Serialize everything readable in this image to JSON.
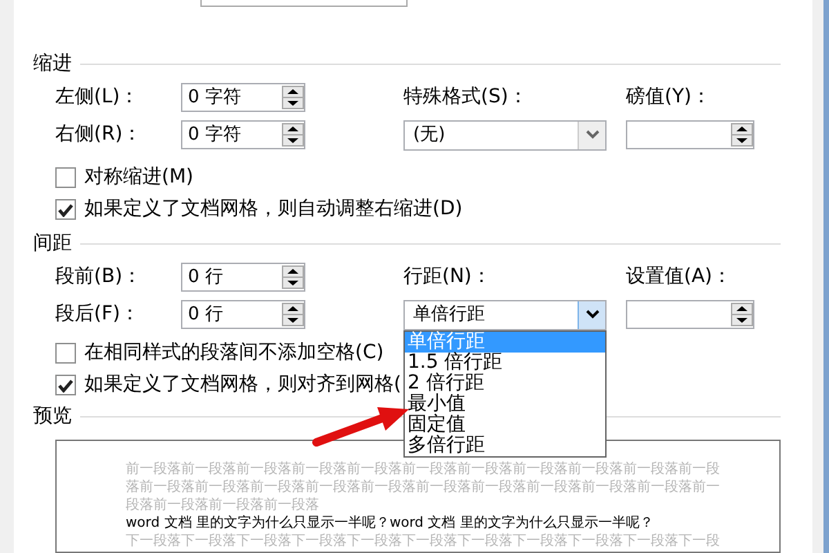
{
  "indent": {
    "title": "缩进",
    "left": {
      "label": "左侧(L)：",
      "value": "0 字符"
    },
    "right": {
      "label": "右侧(R)：",
      "value": "0 字符"
    },
    "special": {
      "label": "特殊格式(S)：",
      "value": "(无)"
    },
    "by": {
      "label": "磅值(Y)："
    },
    "checks": [
      {
        "label": "对称缩进(M)",
        "checked": false
      },
      {
        "label": "如果定义了文档网格，则自动调整右缩进(D)",
        "checked": true
      }
    ]
  },
  "spacing": {
    "title": "间距",
    "before": {
      "label": "段前(B)：",
      "value": "0 行"
    },
    "after": {
      "label": "段后(F)：",
      "value": "0 行"
    },
    "line_spacing": {
      "label": "行距(N)：",
      "value": "单倍行距",
      "expanded": true,
      "options": [
        {
          "label": "单倍行距",
          "selected": true
        },
        {
          "label": "1.5 倍行距",
          "selected": false
        },
        {
          "label": "2 倍行距",
          "selected": false
        },
        {
          "label": "最小值",
          "selected": false
        },
        {
          "label": "固定值",
          "selected": false
        },
        {
          "label": "多倍行距",
          "selected": false
        }
      ]
    },
    "at": {
      "label": "设置值(A)："
    },
    "checks": [
      {
        "label": "在相同样式的段落间不添加空格(C)",
        "checked": false
      },
      {
        "label": "如果定义了文档网格，则对齐到网格(",
        "checked": true
      }
    ]
  },
  "preview": {
    "title": "预览",
    "previous_lines": [
      "前一段落前一段落前一段落前一段落前一段落前一段落前一段落前一段落前一段落前一段落前一段",
      "落前一段落前一段落前一段落前一段落前一段落前一段落前一段落前一段落前一段落前一段落前一",
      "段落前一段落前一段落前一段落"
    ],
    "sample": "word 文档 里的文字为什么只显示一半呢？word 文档 里的文字为什么只显示一半呢？",
    "next_lines": [
      "下一段落下一段落下一段落下一段落下一段落下一段落下一段落下一段落下一段落下一段落下一段"
    ]
  }
}
